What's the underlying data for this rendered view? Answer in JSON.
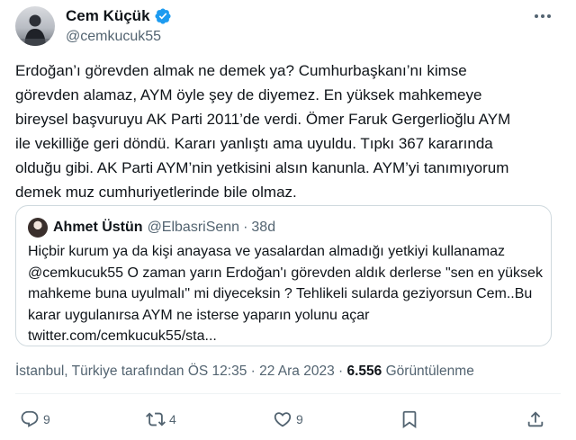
{
  "author": {
    "name": "Cem Küçük",
    "handle": "@cemkucuk55",
    "verified": true,
    "verified_color": "#1d9bf0"
  },
  "tweet": {
    "text": "Erdoğan’ı görevden almak ne demek ya? Cumhurbaşkanı’nı kimse\ngörevden alamaz, AYM öyle şey de diyemez. En yüksek mahkemeye\nbireysel başvuruyu AK Parti 2011’de verdi. Ömer Faruk Gergerlioğlu AYM\nile vekilliğe geri döndü. Kararı yanlıştı ama uyuldu. Tıpkı 367 kararında\nolduğu gibi. AK Parti AYM’nin yetkisini alsın kanunla. AYM’yi tanımıyorum\ndemek muz cumhuriyetlerinde bile olmaz."
  },
  "quote": {
    "name": "Ahmet Üstün",
    "handle": "@ElbasriSenn",
    "separator": "·",
    "time": "38d",
    "text": "Hiçbir kurum ya da kişi anayasa ve yasalardan almadığı yetkiyi kullanamaz\n@cemkucuk55 O zaman yarın Erdoğan'ı görevden aldık derlerse \"sen en yüksek\nmahkeme buna uyulmalı\" mi diyeceksin ? Tehlikeli sularda geziyorsun Cem..Bu\nkarar uygulanırsa AYM ne isterse yaparın yolunu açar\ntwitter.com/cemkucuk55/sta..."
  },
  "meta": {
    "location_time": "İstanbul, Türkiye tarafından ÖS 12:35 · 22 Ara 2023 · ",
    "views_count": "6.556",
    "views_label": " Görüntülenme"
  },
  "actions": {
    "reply_count": "9",
    "retweet_count": "4",
    "like_count": "9"
  },
  "icons": {
    "verified": "verified-badge-icon",
    "more": "more-options-icon",
    "reply": "reply-icon",
    "retweet": "retweet-icon",
    "like": "heart-icon",
    "bookmark": "bookmark-icon",
    "share": "share-icon"
  }
}
